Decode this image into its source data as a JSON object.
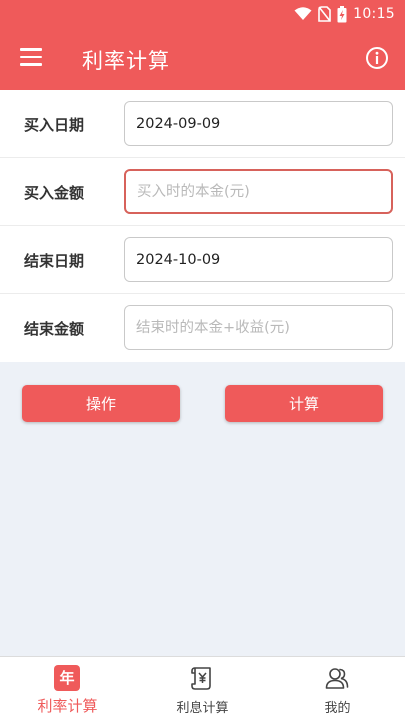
{
  "status_bar": {
    "time": "10:15",
    "icons": [
      "wifi-icon",
      "no-sim-icon",
      "battery-charging-icon"
    ]
  },
  "app_bar": {
    "title": "利率计算",
    "menu_icon": "menu-icon",
    "info_icon": "info-icon"
  },
  "form": {
    "rows": [
      {
        "label": "买入日期",
        "value": "2024-09-09",
        "placeholder": ""
      },
      {
        "label": "买入金额",
        "value": "",
        "placeholder": "买入时的本金(元)"
      },
      {
        "label": "结束日期",
        "value": "2024-10-09",
        "placeholder": ""
      },
      {
        "label": "结束金额",
        "value": "",
        "placeholder": "结束时的本金+收益(元)"
      }
    ]
  },
  "buttons": {
    "operate": "操作",
    "calculate": "计算"
  },
  "bottom_nav": {
    "items": [
      {
        "label": "利率计算",
        "icon": "nian-icon",
        "badge": "年",
        "active": true
      },
      {
        "label": "利息计算",
        "icon": "scroll-yuan-icon",
        "active": false
      },
      {
        "label": "我的",
        "icon": "users-icon",
        "active": false
      }
    ]
  },
  "colors": {
    "primary": "#ef5a5a",
    "background": "#edf1f7",
    "active_field_border": "#d7625b"
  }
}
